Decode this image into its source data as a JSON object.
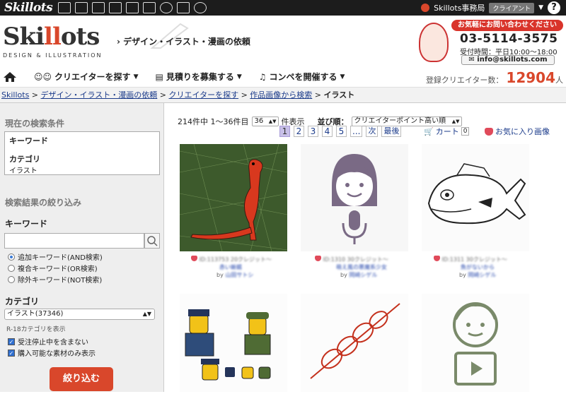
{
  "topbar": {
    "logo": "Skillots",
    "user": "Skillots事務局",
    "badge": "クライアント",
    "help": "?"
  },
  "header": {
    "logo_main": "Ski",
    "logo_ll": "ll",
    "logo_end": "ots",
    "logo_sub": "DESIGN & ILLUSTRATION",
    "title": "デザイン・イラスト・漫画の依頼",
    "contact": {
      "pill": "お気軽にお問い合わせください",
      "tel": "03-5114-3575",
      "hours": "受付時間：平日10:00～18:00",
      "mail": "info@skillots.com"
    }
  },
  "nav": {
    "items": [
      "クリエイターを探す",
      "見積りを募集する",
      "コンペを開催する"
    ],
    "count_label": "登録クリエイター数：",
    "count": "12904",
    "count_unit": "人"
  },
  "breadcrumb": {
    "items": [
      "Skillots",
      "デザイン・イラスト・漫画の依頼",
      "クリエイターを探す",
      "作品画像から検索"
    ],
    "current": "イラスト"
  },
  "sidebar": {
    "cond_title": "現在の検索条件",
    "kw_label": "キーワード",
    "cat_label": "カテゴリ",
    "cat_value": "イラスト",
    "refine_title": "検索結果の絞り込み",
    "kw_heading": "キーワード",
    "kw_value": "",
    "radios": [
      "追加キーワード(AND検索)",
      "複合キーワード(OR検索)",
      "除外キーワード(NOT検索)"
    ],
    "cat_heading": "カテゴリ",
    "cat_select": "イラスト(37346)",
    "r18": "R-18カテゴリを表示",
    "checks": [
      "受注停止中を含まない",
      "購入可能な素材のみ表示"
    ],
    "submit": "絞り込む"
  },
  "results": {
    "summary": "214件中 1〜36件目",
    "per_page": "36",
    "per_page_suffix": "件表示",
    "sort_label": "並び順：",
    "sort_value": "クリエイターポイント高い順",
    "pages": [
      "1",
      "2",
      "3",
      "4",
      "5",
      "...",
      "次",
      "最後"
    ],
    "cart_label": "カート",
    "cart_count": "0",
    "fav_label": "お気に入り画像"
  },
  "cards": [
    {
      "id": "ID:113753",
      "credit": "20クレジット〜",
      "title": "赤い蜥蜴",
      "by": "by",
      "author": "山田サトシ"
    },
    {
      "id": "ID:1310",
      "credit": "30クレジット〜",
      "title": "萌え風の悪魔系少女",
      "by": "by",
      "author": "岡崎シゲル"
    },
    {
      "id": "ID:1311",
      "credit": "30クレジット〜",
      "title": "魚がないから",
      "by": "by",
      "author": "岡崎シゲル"
    }
  ],
  "colors": {
    "accent": "#d9472b",
    "link": "#1a3a8a",
    "topbar": "#1c1c1c"
  }
}
